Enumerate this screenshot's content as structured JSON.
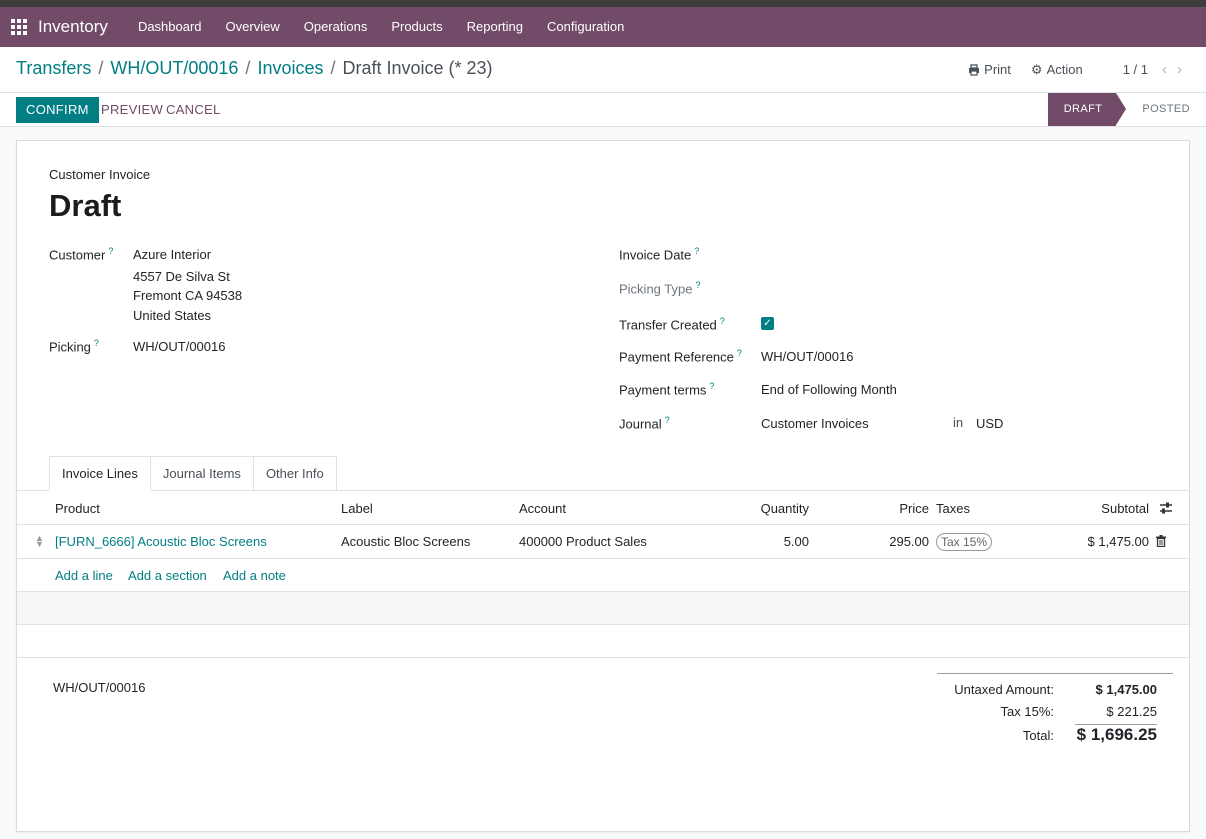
{
  "navbar": {
    "app_name": "Inventory",
    "menu": [
      "Dashboard",
      "Overview",
      "Operations",
      "Products",
      "Reporting",
      "Configuration"
    ]
  },
  "breadcrumb": {
    "items": [
      "Transfers",
      "WH/OUT/00016",
      "Invoices"
    ],
    "current": "Draft Invoice (* 23)"
  },
  "cp_buttons": {
    "print": "Print",
    "action": "Action",
    "pager": "1 / 1"
  },
  "buttons": {
    "confirm": "CONFIRM",
    "preview": "PREVIEW",
    "cancel": "CANCEL"
  },
  "statusbar": {
    "draft": "DRAFT",
    "posted": "POSTED"
  },
  "form": {
    "type": "Customer Invoice",
    "title": "Draft",
    "customer_label": "Customer",
    "customer_name": "Azure Interior",
    "address": [
      "4557 De Silva St",
      "Fremont CA 94538",
      "United States"
    ],
    "picking_label": "Picking",
    "picking": "WH/OUT/00016",
    "invoice_date_label": "Invoice Date",
    "picking_type_label": "Picking Type",
    "transfer_created_label": "Transfer Created",
    "transfer_created": true,
    "payment_ref_label": "Payment Reference",
    "payment_ref": "WH/OUT/00016",
    "payment_terms_label": "Payment terms",
    "payment_terms": "End of Following Month",
    "journal_label": "Journal",
    "journal": "Customer Invoices",
    "journal_in": "in",
    "currency": "USD",
    "help": "?"
  },
  "tabs": [
    "Invoice Lines",
    "Journal Items",
    "Other Info"
  ],
  "table": {
    "headers": {
      "product": "Product",
      "label": "Label",
      "account": "Account",
      "quantity": "Quantity",
      "price": "Price",
      "taxes": "Taxes",
      "subtotal": "Subtotal"
    },
    "rows": [
      {
        "product": "[FURN_6666] Acoustic Bloc Screens",
        "label": "Acoustic Bloc Screens",
        "account": "400000 Product Sales",
        "quantity": "5.00",
        "price": "295.00",
        "tax": "Tax 15%",
        "subtotal": "$ 1,475.00"
      }
    ],
    "add": {
      "line": "Add a line",
      "section": "Add a section",
      "note": "Add a note"
    }
  },
  "footer": {
    "reference": "WH/OUT/00016",
    "untaxed_label": "Untaxed Amount:",
    "untaxed": "$ 1,475.00",
    "tax_label": "Tax 15%:",
    "tax": "$ 221.25",
    "total_label": "Total:",
    "total": "$ 1,696.25"
  }
}
